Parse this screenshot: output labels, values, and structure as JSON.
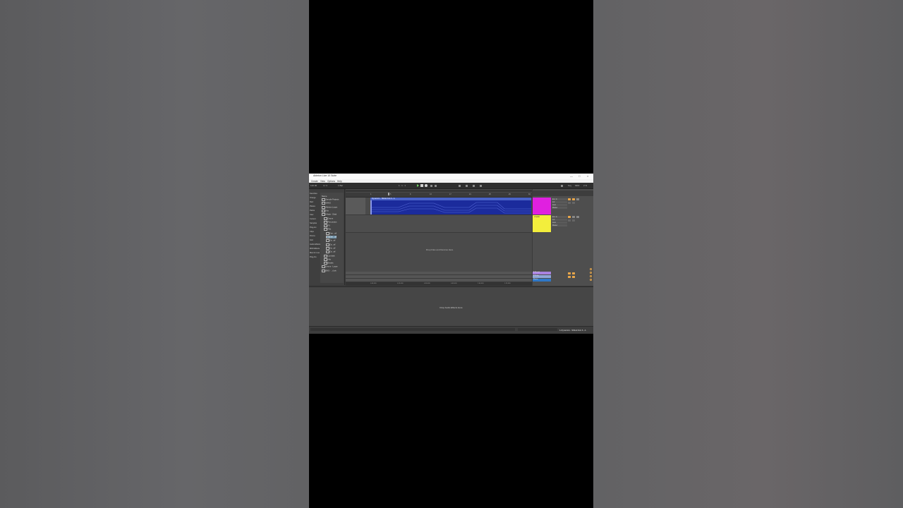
{
  "window": {
    "title": "Ableton Live 10 Suite",
    "controls": [
      "—",
      "□",
      "×"
    ]
  },
  "menu": [
    "Create",
    "View",
    "Options",
    "Help"
  ],
  "transport": {
    "bpm": "120.00",
    "time_sig": "4 / 4",
    "bar_label": "1 Bar",
    "position": "1 . 1 . 1",
    "key_label": "Key",
    "midi_label": "MIDI",
    "cpu": "2 %"
  },
  "browser": {
    "collections": [
      "Favorites",
      "Orange",
      "Red",
      "Places",
      "Packs",
      "User",
      "Current",
      "Samples",
      "Plug-ins",
      "Clips",
      "Drums",
      "Instr",
      "Audio Effects",
      "MIDI Effects",
      "Max for Live",
      "Plug-Ins"
    ],
    "tree_header": "Name",
    "tree_items": [
      {
        "label": "Sample Projects",
        "indent": 0,
        "selected": false
      },
      {
        "label": "WAVS",
        "indent": 0,
        "selected": false
      },
      {
        "label": "Ableton Loops",
        "indent": 0,
        "selected": false
      },
      {
        "label": "Kits",
        "indent": 0,
        "selected": false
      },
      {
        "label": "Hihats - Shak",
        "indent": 0,
        "selected": false
      },
      {
        "label": "Drums",
        "indent": 1,
        "selected": false
      },
      {
        "label": "Percussion",
        "indent": 1,
        "selected": false
      },
      {
        "label": "FX",
        "indent": 1,
        "selected": false
      },
      {
        "label": "Fills",
        "indent": 1,
        "selected": false
      },
      {
        "label": "Dyn...aif",
        "indent": 2,
        "selected": false
      },
      {
        "label": "Dyn...aif",
        "indent": 2,
        "selected": true
      },
      {
        "label": "Dy...aif",
        "indent": 2,
        "selected": false
      },
      {
        "label": "Dy...aif",
        "indent": 2,
        "selected": false
      },
      {
        "label": "Dy...aif",
        "indent": 2,
        "selected": false
      },
      {
        "label": "Dy...aif",
        "indent": 2,
        "selected": false
      },
      {
        "label": "Cymbals",
        "indent": 1,
        "selected": false
      },
      {
        "label": "Hits",
        "indent": 1,
        "selected": false
      },
      {
        "label": "Breaks",
        "indent": 1,
        "selected": false
      },
      {
        "label": "Drums - Loops",
        "indent": 0,
        "selected": false
      },
      {
        "label": "BNS - ...d.aiv",
        "indent": 0,
        "selected": false
      }
    ]
  },
  "arrangement": {
    "ruler_bars": [
      "1",
      "5",
      "9",
      "13",
      "17",
      "21",
      "25",
      "29",
      "33"
    ],
    "clip_name": "Dynamics - SMLE Kick 6 - A",
    "drop_files_text": "Drop Files and Devices Here",
    "time_labels": [
      "0:00:000",
      "0:15:000",
      "0:30:000",
      "0:45:000",
      "1:00:000",
      "1:15:000"
    ]
  },
  "session": {
    "track1_color": "#e020e0",
    "track2_color": "#f3ee3c",
    "track2_clip": "2 Audio",
    "track1_io": [
      "Ext. In",
      "1/2",
      "Auto",
      "Master"
    ],
    "track2_io": [
      "Ext. In",
      "1/2",
      "Auto",
      "Master"
    ],
    "returns": [
      {
        "name": "A Reverb",
        "color": "#a982e0"
      },
      {
        "name": "B Delay",
        "color": "#8fa6d8"
      },
      {
        "name": "Master",
        "color": "#2f78c8"
      }
    ]
  },
  "device_view": {
    "drop_text": "Drop Audio Effects Here"
  },
  "status": {
    "right_text": "1-Dynamics - SMLE Kick 6 - A"
  },
  "colors": {
    "clip_blue": "#1b2b9c",
    "accent_orange": "#e7a64a",
    "play_green": "#6ecf5f"
  }
}
